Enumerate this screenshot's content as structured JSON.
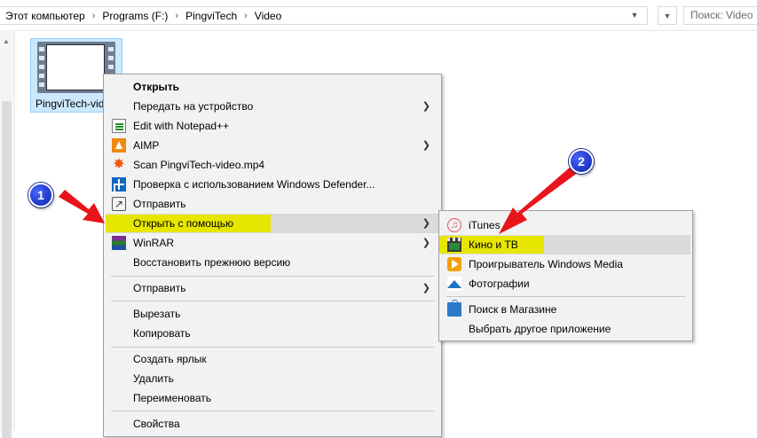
{
  "address_bar": {
    "breadcrumb": [
      "Этот компьютер",
      "Programs (F:)",
      "PingviTech",
      "Video"
    ],
    "search_placeholder": "Поиск: Video"
  },
  "file": {
    "name": "PingviTech-video.mp4",
    "label_shown": "PingviTech-vide"
  },
  "context_menu": {
    "items": [
      {
        "label": "Открыть",
        "bold": true
      },
      {
        "label": "Передать на устройство",
        "submenu": true
      },
      {
        "label": "Edit with Notepad++",
        "icon": "notepad-plus-plus-icon"
      },
      {
        "label": "AIMP",
        "icon": "aimp-icon",
        "submenu": true
      },
      {
        "label": "Scan PingviTech-video.mp4",
        "icon": "avast-icon"
      },
      {
        "label": "Проверка с использованием Windows Defender...",
        "icon": "windows-defender-icon"
      },
      {
        "label": "Отправить",
        "icon": "share-icon"
      },
      {
        "label": "Открыть с помощью",
        "submenu": true,
        "highlighted": true
      },
      {
        "label": "WinRAR",
        "icon": "winrar-icon",
        "submenu": true
      },
      {
        "label": "Восстановить прежнюю версию"
      },
      {
        "label": "Отправить",
        "submenu": true
      },
      {
        "label": "Вырезать"
      },
      {
        "label": "Копировать"
      },
      {
        "label": "Создать ярлык"
      },
      {
        "label": "Удалить"
      },
      {
        "label": "Переименовать"
      },
      {
        "label": "Свойства"
      }
    ]
  },
  "open_with_submenu": {
    "items": [
      {
        "label": "iTunes",
        "icon": "itunes-icon"
      },
      {
        "label": "Кино и ТВ",
        "icon": "movies-tv-icon",
        "highlighted": true
      },
      {
        "label": "Проигрыватель Windows Media",
        "icon": "windows-media-player-icon"
      },
      {
        "label": "Фотографии",
        "icon": "photos-icon"
      },
      {
        "label": "Поиск в Магазине",
        "icon": "store-icon"
      },
      {
        "label": "Выбрать другое приложение"
      }
    ]
  },
  "annotations": {
    "step1": "1",
    "step2": "2",
    "arrow_color": "#e8141b",
    "highlight_color": "#e6e600"
  }
}
